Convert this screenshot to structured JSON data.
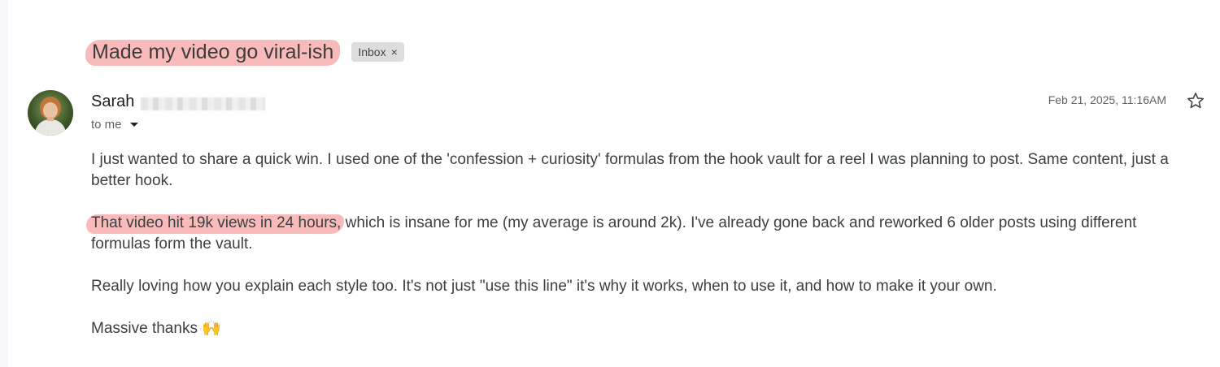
{
  "email": {
    "subject": "Made my video go viral-ish",
    "label_chip": "Inbox",
    "label_chip_close": "×",
    "sender_name": "Sarah",
    "recipient": "to me",
    "date": "Feb 21, 2025, 11:16AM",
    "body": {
      "p1": "I just wanted to share a quick win. I used one of the 'confession + curiosity' formulas from the hook vault for a reel I was planning to post. Same content, just a better hook.",
      "p2_highlight": "That video hit 19k views in 24 hours,",
      "p2_rest": " which is insane for me (my average is around 2k). I've already gone back and reworked 6 older posts using different formulas form the vault.",
      "p3": "Really loving how you explain each style too. It's not just \"use this line\" it's why it works, when to use it, and how to make it your own.",
      "p4": "Massive thanks 🙌"
    }
  },
  "icons": {
    "star": "star-icon",
    "caret": "chevron-down-icon",
    "avatar": "avatar"
  },
  "colors": {
    "highlight": "#f06e6e",
    "chip_bg": "#dddddd",
    "text": "#3c4043"
  }
}
